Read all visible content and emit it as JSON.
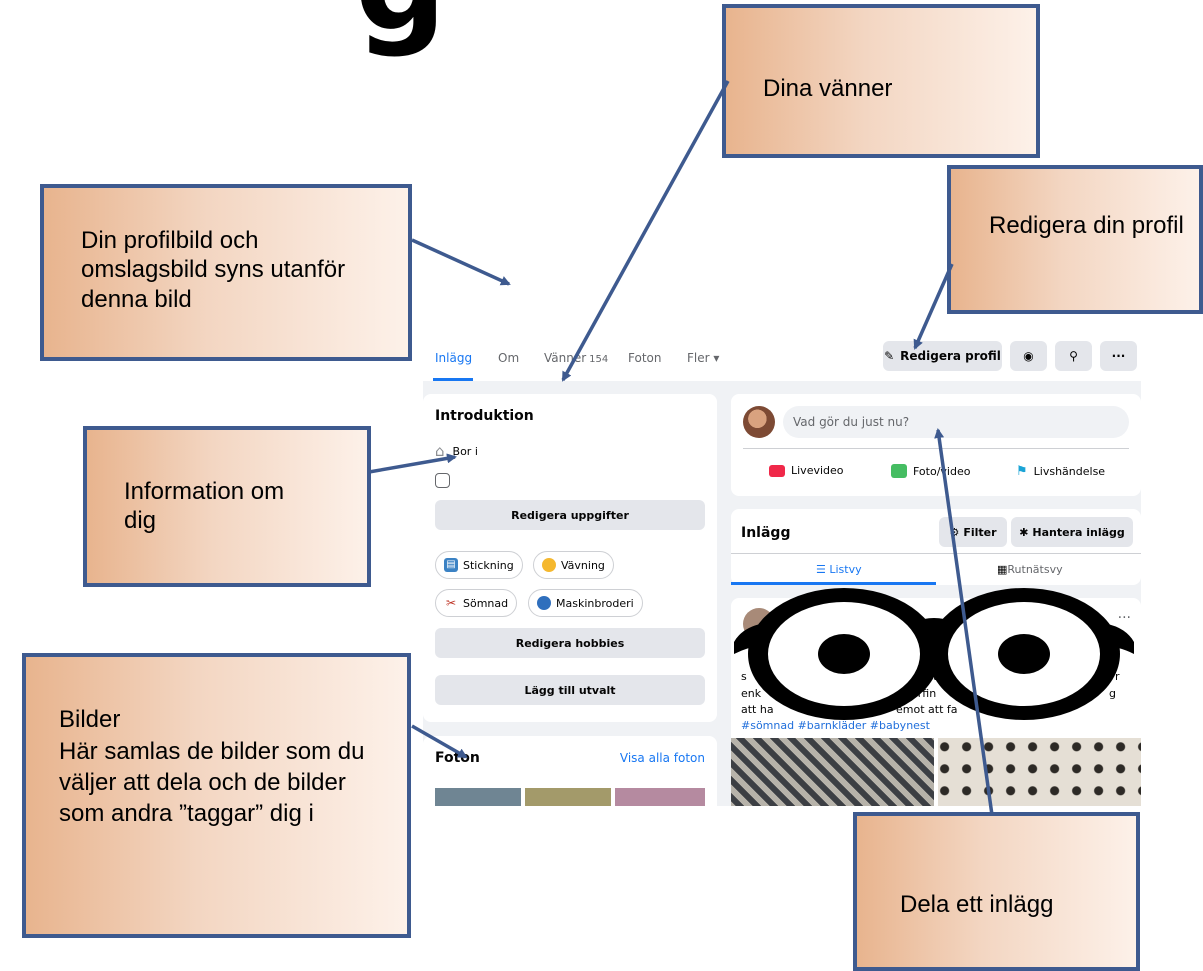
{
  "heading_fragment": "g",
  "callouts": {
    "friends": "Dina vänner",
    "profile_pic": "Din profilbild och omslagsbild syns utanför denna bild",
    "edit_profile": "Redigera din profil",
    "info": "Information om dig",
    "photos_title": "Bilder",
    "photos_text": "Här samlas de bilder som du väljer att dela och de bilder som andra ”taggar” dig i",
    "share_post": "Dela ett inlägg"
  },
  "nav": {
    "tabs": [
      {
        "label": "Inlägg",
        "active": true
      },
      {
        "label": "Om"
      },
      {
        "label": "Vänner",
        "count": "154"
      },
      {
        "label": "Foton"
      },
      {
        "label": "Fler ▾"
      }
    ],
    "edit_profile_label": "Redigera profil"
  },
  "intro": {
    "title": "Introduktion",
    "lives_in": "Bor i",
    "edit_details": "Redigera uppgifter",
    "hobbies": [
      "Stickning",
      "Vävning",
      "Sömnad",
      "Maskinbroderi"
    ],
    "edit_hobbies": "Redigera hobbies",
    "add_featured": "Lägg till utvalt"
  },
  "photos": {
    "title": "Foton",
    "see_all": "Visa alla foton"
  },
  "composer": {
    "placeholder": "Vad gör du just nu?",
    "actions": [
      "Livevideo",
      "Foto/video",
      "Livshändelse"
    ]
  },
  "posts": {
    "title": "Inlägg",
    "filter": "Filter",
    "manage": "Hantera inlägg",
    "list_view": "Listvy",
    "grid_view": "Rutnätsvy",
    "text_lines": [
      "s",
      "t",
      "r",
      "enk",
      "erfin",
      "g",
      "att ha",
      "emot att fa"
    ],
    "hashtags": "#sömnad #barnkläder #babynest"
  },
  "colors": {
    "accent": "#1877f2",
    "callout_border": "#3e5a8f"
  }
}
